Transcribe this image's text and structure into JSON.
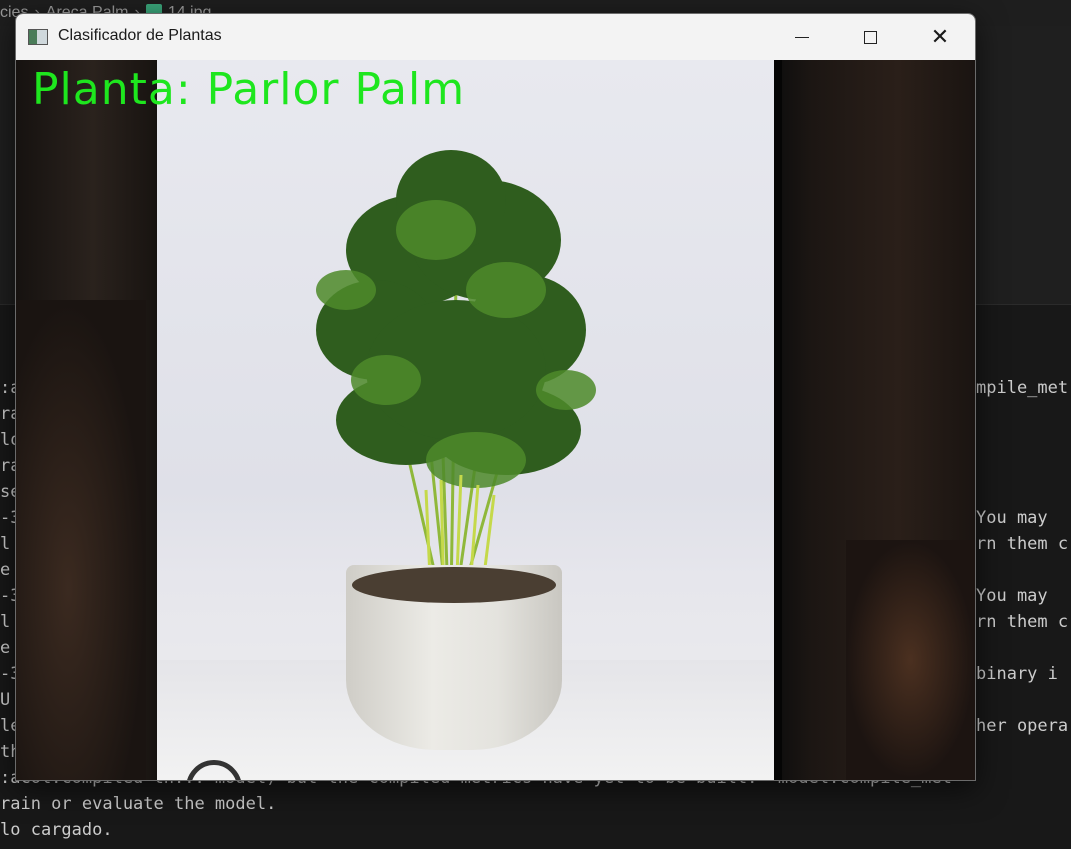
{
  "ide": {
    "breadcrumb": [
      "cies",
      "Areca Palm",
      "14.jpg"
    ],
    "terminal_left": [
      ":a",
      "ra",
      "lo",
      "ra",
      "se",
      "-3",
      "l",
      "e",
      "-3",
      "l",
      "e",
      "-3",
      "U",
      "le",
      "th"
    ],
    "terminal_right": [
      "mpile_met",
      "",
      "",
      "",
      "",
      "You may",
      "rn them c",
      "",
      "You may",
      "rn them c",
      "",
      "binary i",
      "",
      "her opera",
      ""
    ],
    "terminal_bottom": [
      ":acol.compiled th... model) but the compiled metrics have yet to be built.  model.compile_met",
      "rain or evaluate the model.",
      "lo cargado."
    ]
  },
  "window": {
    "title": "Clasificador de Plantas",
    "minimize_label": "",
    "maximize_label": "",
    "close_label": "✕"
  },
  "frame": {
    "prediction": "Planta: Parlor Palm",
    "prediction_color": "#1ee61e"
  }
}
